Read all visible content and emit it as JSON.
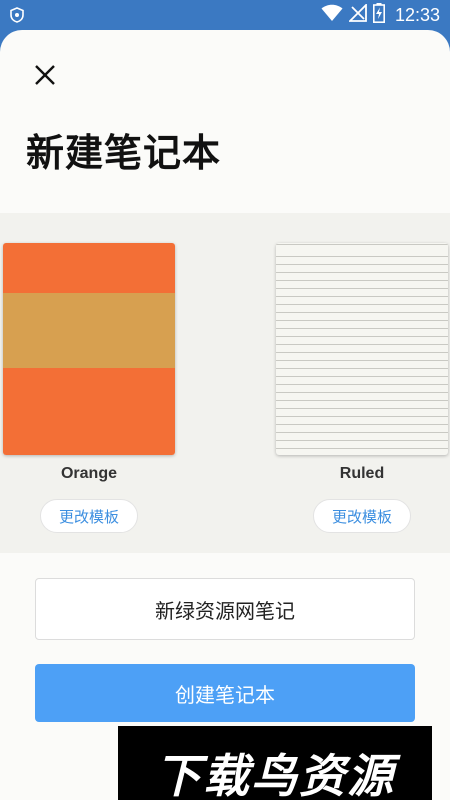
{
  "status_bar": {
    "time": "12:33",
    "icons": [
      "shield-icon",
      "wifi-icon",
      "no-signal-icon",
      "battery-charging-icon"
    ]
  },
  "dialog": {
    "close_icon": "close-icon",
    "title": "新建笔记本"
  },
  "templates": [
    {
      "name": "Orange",
      "change_label": "更改模板",
      "colors": [
        "#f36f36",
        "#d7a050"
      ]
    },
    {
      "name": "Ruled",
      "change_label": "更改模板",
      "colors": [
        "#f6f6f1",
        "#c9c9c3"
      ]
    }
  ],
  "notebook_name": {
    "value": "新绿资源网笔记"
  },
  "create_button": {
    "label": "创建笔记本",
    "color": "#4da0f6"
  },
  "watermark": {
    "text": "下载鸟资源"
  }
}
